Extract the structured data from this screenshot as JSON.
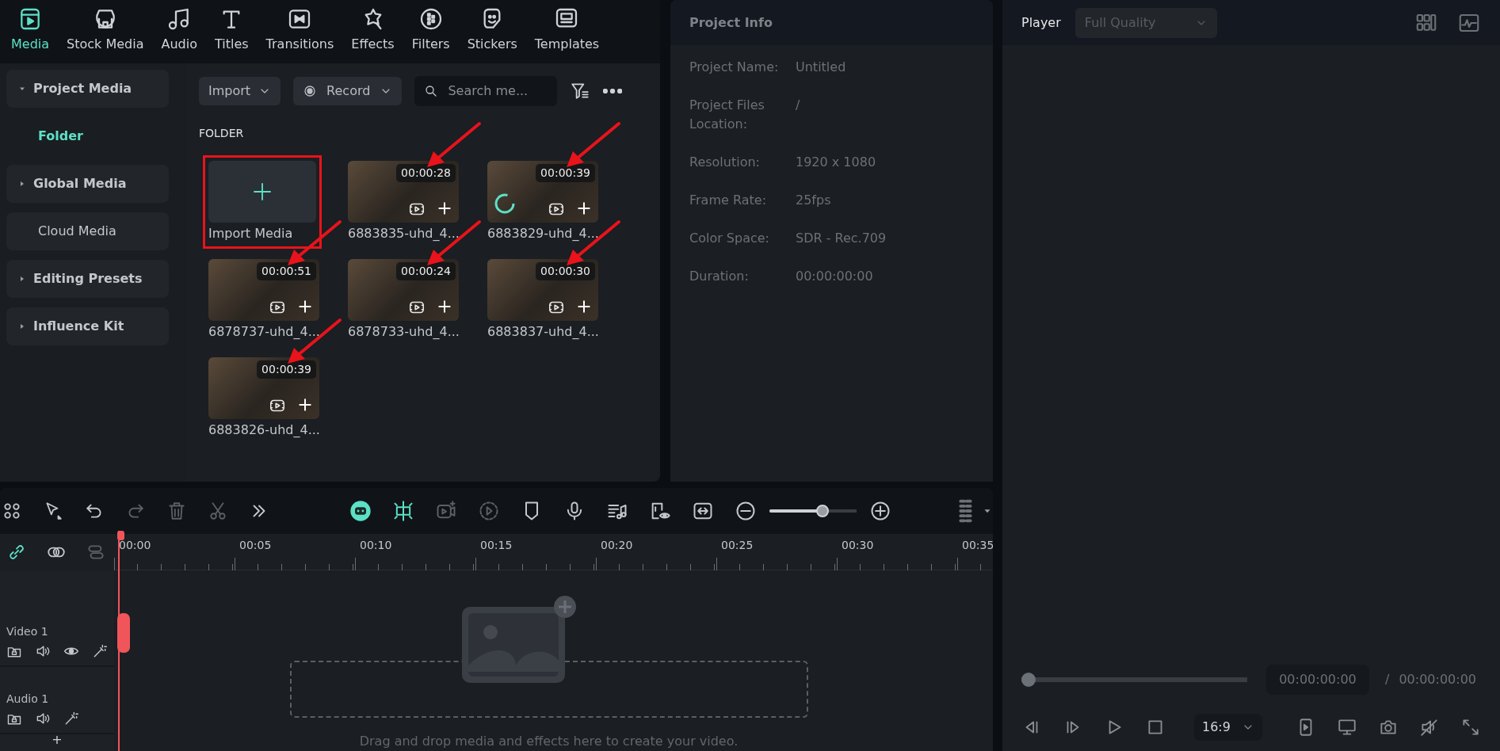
{
  "nav_tabs": [
    {
      "label": "Media",
      "selected": true
    },
    {
      "label": "Stock Media",
      "selected": false
    },
    {
      "label": "Audio",
      "selected": false
    },
    {
      "label": "Titles",
      "selected": false
    },
    {
      "label": "Transitions",
      "selected": false
    },
    {
      "label": "Effects",
      "selected": false
    },
    {
      "label": "Filters",
      "selected": false
    },
    {
      "label": "Stickers",
      "selected": false
    },
    {
      "label": "Templates",
      "selected": false
    }
  ],
  "sidebar": {
    "items": [
      {
        "label": "Project Media",
        "kind": "group",
        "expanded": true,
        "children": [
          {
            "label": "Folder",
            "selected": true
          }
        ]
      },
      {
        "label": "Global Media",
        "kind": "group",
        "expanded": false
      },
      {
        "label": "Cloud Media",
        "kind": "link"
      },
      {
        "label": "Editing Presets",
        "kind": "group",
        "expanded": false
      },
      {
        "label": "Influence Kit",
        "kind": "group",
        "expanded": false
      }
    ]
  },
  "media_toolbar": {
    "import_label": "Import",
    "record_label": "Record",
    "search": {
      "placeholder": "Search me..."
    }
  },
  "folder": {
    "heading": "FOLDER",
    "import_tile": {
      "label": "Import Media",
      "highlighted": true
    },
    "clips": [
      {
        "name": "6883835-uhd_4...",
        "duration": "00:00:28",
        "loading": false,
        "annotated": true
      },
      {
        "name": "6883829-uhd_4...",
        "duration": "00:00:39",
        "loading": true,
        "annotated": true
      },
      {
        "name": "6878737-uhd_4...",
        "duration": "00:00:51",
        "loading": false,
        "annotated": true
      },
      {
        "name": "6878733-uhd_4...",
        "duration": "00:00:24",
        "loading": false,
        "annotated": true
      },
      {
        "name": "6883837-uhd_4...",
        "duration": "00:00:30",
        "loading": false,
        "annotated": true
      },
      {
        "name": "6883826-uhd_4...",
        "duration": "00:00:39",
        "loading": false,
        "annotated": true
      }
    ]
  },
  "project_info": {
    "title": "Project Info",
    "fields": [
      {
        "label": "Project Name:",
        "value": "Untitled"
      },
      {
        "label": "Project Files Location:",
        "value": "/"
      },
      {
        "label": "Resolution:",
        "value": "1920 x 1080"
      },
      {
        "label": "Frame Rate:",
        "value": "25fps"
      },
      {
        "label": "Color Space:",
        "value": "SDR - Rec.709"
      },
      {
        "label": "Duration:",
        "value": "00:00:00:00"
      }
    ]
  },
  "player": {
    "title": "Player",
    "quality": "Full Quality",
    "progress": {
      "level": 0
    },
    "current_time": "00:00:00:00",
    "separator": "/",
    "total_time": "00:00:00:00",
    "aspect_ratio": "16:9"
  },
  "timeline": {
    "zoom": {
      "level": 0.61
    },
    "ruler": [
      "00:00",
      "00:05",
      "00:10",
      "00:15",
      "00:20",
      "00:25",
      "00:30",
      "00:35"
    ],
    "tracks": [
      {
        "name": "Video 1",
        "kind": "video"
      },
      {
        "name": "Audio 1",
        "kind": "audio"
      }
    ],
    "add_track": "+",
    "drop_hint": "Drag and drop media and effects here to create your video."
  }
}
